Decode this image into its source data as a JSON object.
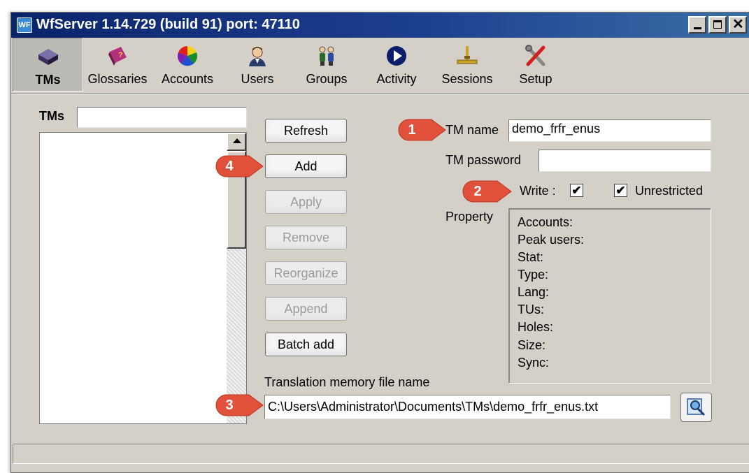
{
  "window": {
    "title": "WfServer 1.14.729 (build 91)   port: 47110",
    "app_icon_text": "WF",
    "controls": {
      "minimize_icon": "minimize-icon",
      "maximize_icon": "maximize-icon",
      "close_icon": "close-icon",
      "close_glyph": "✕"
    }
  },
  "toolbar": {
    "items": [
      {
        "label": "TMs",
        "icon": "tm-database-icon",
        "selected": true
      },
      {
        "label": "Glossaries",
        "icon": "glossary-book-icon"
      },
      {
        "label": "Accounts",
        "icon": "accounts-color-wheel-icon"
      },
      {
        "label": "Users",
        "icon": "user-person-icon"
      },
      {
        "label": "Groups",
        "icon": "group-people-icon"
      },
      {
        "label": "Activity",
        "icon": "activity-play-icon"
      },
      {
        "label": "Sessions",
        "icon": "sessions-network-icon"
      },
      {
        "label": "Setup",
        "icon": "setup-tools-icon"
      }
    ]
  },
  "tms": {
    "filter_label": "TMs",
    "filter_value": "",
    "list_items": []
  },
  "buttons": {
    "refresh": "Refresh",
    "add": "Add",
    "apply": "Apply",
    "remove": "Remove",
    "reorganize": "Reorganize",
    "append": "Append",
    "batch_add": "Batch add"
  },
  "form": {
    "tm_name_label": "TM name",
    "tm_name_value": "demo_frfr_enus",
    "tm_password_label": "TM password",
    "tm_password_value": "",
    "write_label": "Write :",
    "write_checked": true,
    "unrestricted_label": "Unrestricted",
    "unrestricted_checked": true,
    "check_glyph": "✔",
    "property_label": "Property",
    "properties": [
      "Accounts:",
      "Peak users:",
      "Stat:",
      "Type:",
      "Lang:",
      "TUs:",
      "Holes:",
      "Size:",
      "Sync:"
    ],
    "file_label": "Translation memory file name",
    "file_value": "C:\\Users\\Administrator\\Documents\\TMs\\demo_frfr_enus.txt",
    "browse_icon": "browse-search-icon"
  },
  "callouts": [
    "1",
    "2",
    "3",
    "4"
  ],
  "colors": {
    "callout": "#e0503a",
    "titlebar": "#0a246a",
    "window": "#d4d0c8"
  }
}
